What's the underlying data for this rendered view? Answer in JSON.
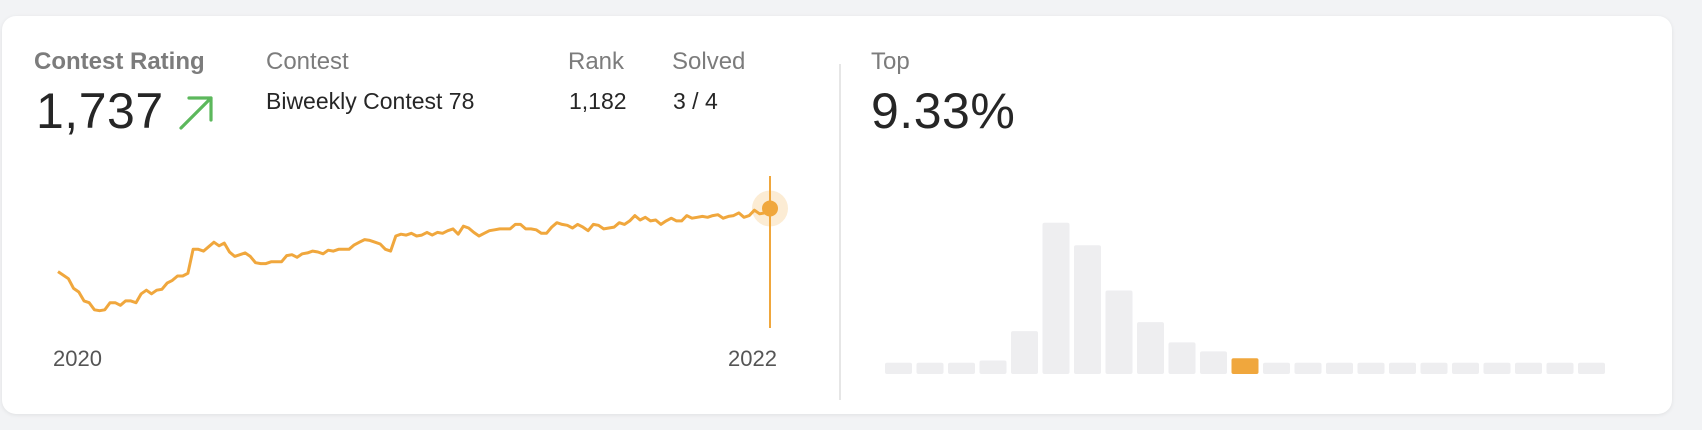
{
  "rating": {
    "label": "Contest Rating",
    "value": "1,737",
    "trend_icon": "arrow-up-right-icon",
    "trend_color": "#5cb85c"
  },
  "contest": {
    "label": "Contest",
    "value": "Biweekly Contest 78"
  },
  "rank": {
    "label": "Rank",
    "value": "1,182"
  },
  "solved": {
    "label": "Solved",
    "value": "3 / 4"
  },
  "top": {
    "label": "Top",
    "value": "9.33%"
  },
  "colors": {
    "accent": "#f0a73d",
    "bar_gray": "#eeeef0",
    "highlight_bar": "#f0a73d"
  },
  "chart_data": [
    {
      "type": "line",
      "x_tick_labels": [
        "2020",
        "2022"
      ],
      "values": [
        1505,
        1501,
        1497,
        1486,
        1482,
        1472,
        1470,
        1462,
        1461,
        1462,
        1470,
        1470,
        1467,
        1472,
        1472,
        1470,
        1480,
        1484,
        1480,
        1484,
        1485,
        1492,
        1495,
        1500,
        1500,
        1503,
        1530,
        1530,
        1528,
        1533,
        1538,
        1534,
        1537,
        1527,
        1522,
        1524,
        1526,
        1522,
        1515,
        1514,
        1514,
        1516,
        1516,
        1516,
        1523,
        1524,
        1521,
        1525,
        1526,
        1528,
        1527,
        1525,
        1529,
        1528,
        1530,
        1530,
        1530,
        1535,
        1538,
        1541,
        1540,
        1538,
        1536,
        1530,
        1528,
        1545,
        1547,
        1546,
        1548,
        1545,
        1546,
        1549,
        1546,
        1549,
        1548,
        1551,
        1553,
        1547,
        1556,
        1554,
        1549,
        1545,
        1548,
        1551,
        1552,
        1553,
        1553,
        1553,
        1558,
        1558,
        1553,
        1553,
        1552,
        1548,
        1548,
        1555,
        1560,
        1558,
        1557,
        1554,
        1558,
        1555,
        1551,
        1558,
        1557,
        1553,
        1554,
        1555,
        1560,
        1558,
        1562,
        1568,
        1563,
        1566,
        1562,
        1563,
        1558,
        1562,
        1565,
        1562,
        1562,
        1568,
        1565,
        1566,
        1567,
        1566,
        1568,
        1569,
        1565,
        1567,
        1568,
        1571,
        1566,
        1568,
        1574,
        1570,
        1571,
        1576
      ],
      "highlight_index": 137
    },
    {
      "type": "bar",
      "values": [
        5,
        5,
        5,
        6,
        19,
        67,
        57,
        37,
        23,
        14,
        10,
        7,
        5,
        5,
        5,
        5,
        5,
        5,
        5,
        5,
        5,
        5,
        5
      ],
      "highlight_index": 11
    }
  ]
}
